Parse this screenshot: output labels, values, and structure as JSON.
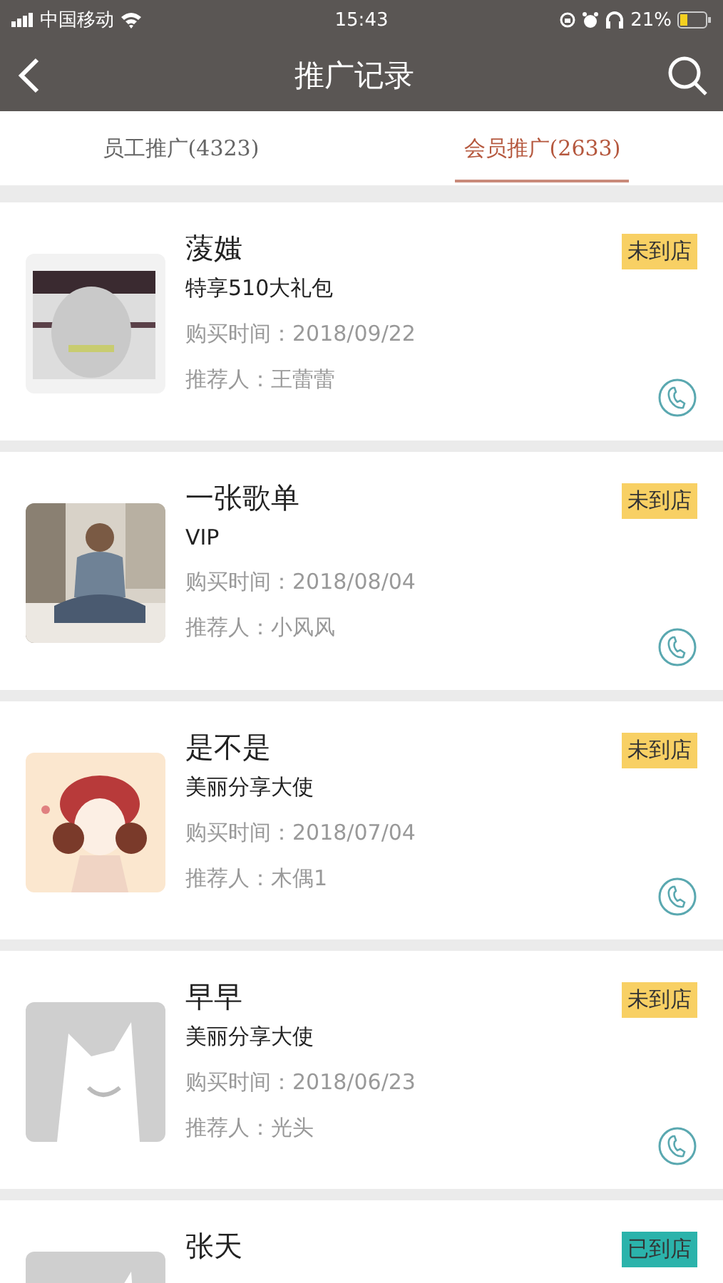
{
  "status_bar": {
    "carrier": "中国移动",
    "time": "15:43",
    "battery": "21%"
  },
  "nav": {
    "title": "推广记录"
  },
  "tabs": [
    {
      "label": "员工推广(4323)",
      "selected": false
    },
    {
      "label": "会员推广(2633)",
      "selected": true
    }
  ],
  "records": [
    {
      "name": "蔆媸",
      "package": "特享510大礼包",
      "purchase_time": "购买时间：2018/09/22",
      "referrer": "推荐人：王蕾蕾",
      "badge": {
        "text": "未到店",
        "color": "#f8d064"
      }
    },
    {
      "name": "一张歌单",
      "package": "VIP",
      "purchase_time": "购买时间：2018/08/04",
      "referrer": "推荐人：小风风",
      "badge": {
        "text": "未到店",
        "color": "#f8d064"
      }
    },
    {
      "name": "是不是",
      "package": "美丽分享大使",
      "purchase_time": "购买时间：2018/07/04",
      "referrer": "推荐人：木偶1",
      "badge": {
        "text": "未到店",
        "color": "#f8d064"
      }
    },
    {
      "avatar": {
        "kind": "placeholder"
      },
      "name": "早早",
      "package": "美丽分享大使",
      "purchase_time": "购买时间：2018/06/23",
      "referrer": "推荐人：光头",
      "badge": {
        "text": "未到店",
        "color": "#f8d064"
      }
    },
    {
      "avatar": {
        "kind": "placeholder"
      },
      "name": "张天",
      "badge": {
        "text": "已到店",
        "color": "#2bb3ab"
      }
    }
  ]
}
